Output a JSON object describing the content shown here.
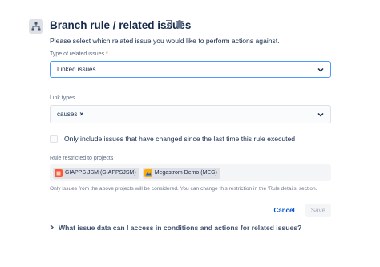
{
  "header": {
    "title": "Branch rule / related issues",
    "icon": "branch-icon",
    "accent": "#42526e"
  },
  "description": "Please select which related issue you would like to perform actions against.",
  "related_type": {
    "label": "Type of related issues",
    "required_mark": "*",
    "value": "Linked issues"
  },
  "link_types": {
    "label": "Link types",
    "selected": [
      {
        "label": "causes",
        "remove": "×"
      }
    ]
  },
  "changed_only": {
    "label": "Only include issues that have changed since the last time this rule executed",
    "checked": false
  },
  "projects": {
    "label": "Rule restricted to projects",
    "items": [
      {
        "name": "GIAPPS JSM (GIAPPSJSM)",
        "icon_color": "#ff5630"
      },
      {
        "name": "Megastrom Demo (MEG)",
        "icon_color": "#ffab00"
      }
    ],
    "helper": "Only issues from the above projects will be considered. You can change this restriction in the 'Rule details' section."
  },
  "actions": {
    "cancel": "Cancel",
    "save": "Save"
  },
  "faq": {
    "label": "What issue data can I access in conditions and actions for related issues?"
  }
}
